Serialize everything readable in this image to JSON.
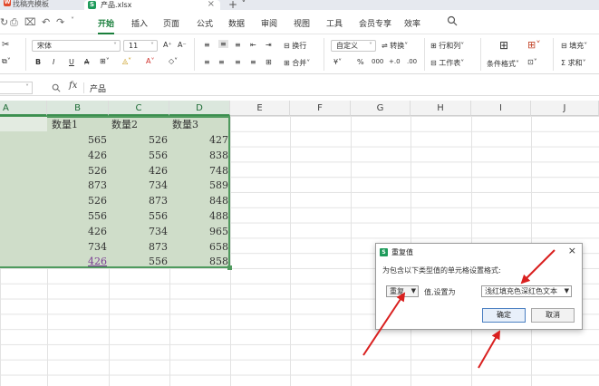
{
  "tabs": {
    "prev_label": "找稿壳模板",
    "active_label": "产品.xlsx",
    "new_tab": "+ ˅"
  },
  "menu": {
    "items": [
      "开始",
      "插入",
      "页面",
      "公式",
      "数据",
      "审阅",
      "视图",
      "工具",
      "会员专享",
      "效率"
    ],
    "active": "开始"
  },
  "ribbon": {
    "font_name": "宋体",
    "font_size": "11",
    "number_format": "自定义",
    "convert": "转换",
    "rowcol": "行和列",
    "worksheet": "工作表",
    "fill": "填充",
    "sum": "求和",
    "wrap": "换行",
    "merge": "合并",
    "conditional": "条件格式",
    "bold": "B",
    "italic": "I",
    "underline": "U",
    "strike": "A",
    "percent": "%"
  },
  "formula_bar": {
    "fx": "fx",
    "value": "产品"
  },
  "columns": [
    "A",
    "B",
    "C",
    "D",
    "E",
    "F",
    "G",
    "H",
    "I",
    "J"
  ],
  "sheet": {
    "headers": [
      "数量1",
      "数量2",
      "数量3"
    ],
    "rows": [
      [
        "565",
        "526",
        "427"
      ],
      [
        "426",
        "556",
        "838"
      ],
      [
        "526",
        "426",
        "748"
      ],
      [
        "873",
        "734",
        "589"
      ],
      [
        "526",
        "873",
        "848"
      ],
      [
        "556",
        "556",
        "488"
      ],
      [
        "426",
        "734",
        "965"
      ],
      [
        "734",
        "873",
        "658"
      ],
      [
        "426",
        "556",
        "858"
      ]
    ]
  },
  "dialog": {
    "title": "重复值",
    "description": "为包含以下类型值的单元格设置格式:",
    "type_value": "重复",
    "label": "值,设置为",
    "format_value": "浅红填充色深红色文本",
    "ok": "确定",
    "cancel": "取消"
  },
  "colors": {
    "accent": "#1a7f3c",
    "selection_fill": "#cfddc9",
    "arrow": "#d9201f"
  }
}
